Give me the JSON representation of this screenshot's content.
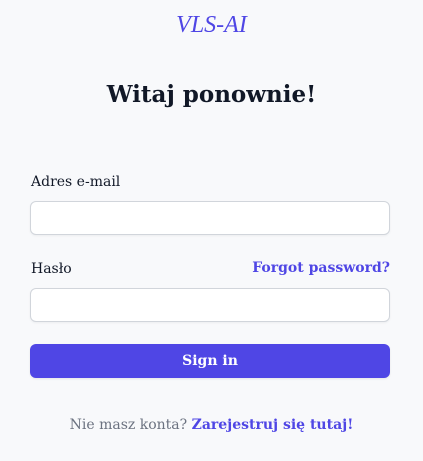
{
  "brand": {
    "name": "VLS-AI"
  },
  "form": {
    "heading": "Witaj ponownie!",
    "email": {
      "label": "Adres e-mail",
      "value": "",
      "placeholder": ""
    },
    "password": {
      "label": "Hasło",
      "value": "",
      "placeholder": "",
      "forgot_link": "Forgot password?"
    },
    "submit_label": "Sign in"
  },
  "footer": {
    "prompt": "Nie masz konta?",
    "register_link": "Zarejestruj się tutaj!"
  },
  "colors": {
    "accent": "#4f46e5",
    "background": "#f8f9fb",
    "input_border": "#d1d5db",
    "text": "#111827",
    "muted_text": "#6b7280"
  }
}
